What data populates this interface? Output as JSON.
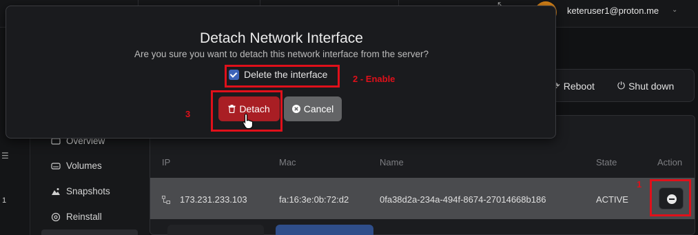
{
  "header": {
    "user_email": "keteruser1@proton.me"
  },
  "left_rail": {
    "number": "1"
  },
  "sidebar": {
    "items": [
      {
        "label": "Overview",
        "icon": "overview-icon"
      },
      {
        "label": "Volumes",
        "icon": "volume-icon"
      },
      {
        "label": "Snapshots",
        "icon": "snapshot-icon"
      },
      {
        "label": "Reinstall",
        "icon": "reinstall-icon"
      }
    ]
  },
  "server_actions": {
    "reboot_label": "Reboot",
    "shutdown_label": "Shut down"
  },
  "table": {
    "columns": [
      "IP",
      "Mac",
      "Name",
      "State",
      "Action"
    ],
    "rows": [
      {
        "ip": "173.231.233.103",
        "mac": "fa:16:3e:0b:72:d2",
        "name": "0fa38d2a-234a-494f-8674-27014668b186",
        "state": "ACTIVE"
      }
    ]
  },
  "modal": {
    "title": "Detach Network Interface",
    "subtitle": "Are you sure you want to detach this network interface from the server?",
    "checkbox_label": "Delete the interface",
    "checkbox_checked": true,
    "detach_label": "Detach",
    "cancel_label": "Cancel"
  },
  "annotations": {
    "step1": "1",
    "step2": "2 - Enable",
    "step3": "3"
  },
  "colors": {
    "accent_blue": "#3d63b8",
    "danger_red": "#a91e24",
    "annotation_red": "#e0101a",
    "avatar_orange": "#d98418"
  }
}
